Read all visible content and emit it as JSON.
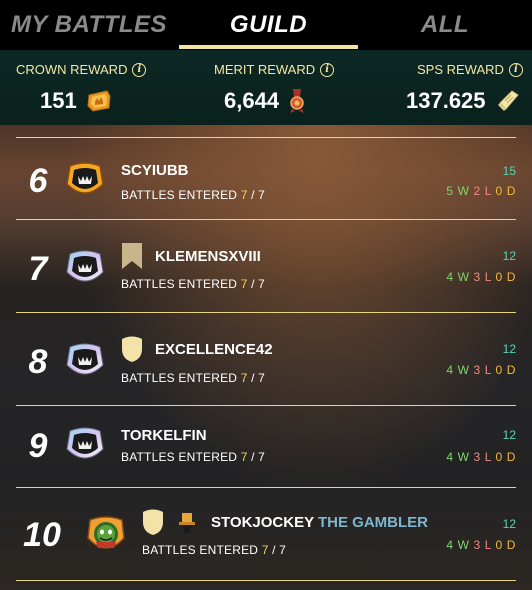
{
  "tabs": [
    {
      "label": "MY BATTLES",
      "active": false
    },
    {
      "label": "GUILD",
      "active": true
    },
    {
      "label": "ALL",
      "active": false
    }
  ],
  "rewards": {
    "crown": {
      "label": "CROWN REWARD",
      "value": "151",
      "icon": "crown-token-icon"
    },
    "merit": {
      "label": "MERIT REWARD",
      "value": "6,644",
      "icon": "merit-medal-icon"
    },
    "sps": {
      "label": "SPS REWARD",
      "value": "137.625",
      "icon": "sps-scroll-icon"
    }
  },
  "info_glyph": "i",
  "battles_label": "BATTLES ENTERED",
  "record_letters": {
    "w": "W",
    "l": "L",
    "d": "D"
  },
  "players": [
    {
      "rank": "6",
      "name": "SCYIUBB",
      "title": "",
      "badge": "gold-frame",
      "flag": "",
      "entered": "7",
      "total": "7",
      "points": "15",
      "wins": "5",
      "losses": "2",
      "draws": "0"
    },
    {
      "rank": "7",
      "name": "KLEMENSXVIII",
      "title": "",
      "badge": "silver-frame",
      "flag": "banner",
      "entered": "7",
      "total": "7",
      "points": "12",
      "wins": "4",
      "losses": "3",
      "draws": "0"
    },
    {
      "rank": "8",
      "name": "EXCELLENCE42",
      "title": "",
      "badge": "silver-frame",
      "flag": "shield",
      "entered": "7",
      "total": "7",
      "points": "12",
      "wins": "4",
      "losses": "3",
      "draws": "0"
    },
    {
      "rank": "9",
      "name": "TORKELFIN",
      "title": "",
      "badge": "silver-frame",
      "flag": "",
      "entered": "7",
      "total": "7",
      "points": "12",
      "wins": "4",
      "losses": "3",
      "draws": "0"
    },
    {
      "rank": "10",
      "name": "STOKJOCKEY",
      "title": "THE GAMBLER",
      "badge": "goblin-avatar",
      "flag": "shield-hat",
      "entered": "7",
      "total": "7",
      "points": "12",
      "wins": "4",
      "losses": "3",
      "draws": "0"
    }
  ],
  "colors": {
    "accent": "#f5e3a0",
    "divider": "#e9d58a",
    "points": "#56d6b8",
    "win": "#7fd66f",
    "loss": "#ef8a82",
    "draw": "#f3b93a",
    "title": "#7fb6cf"
  }
}
